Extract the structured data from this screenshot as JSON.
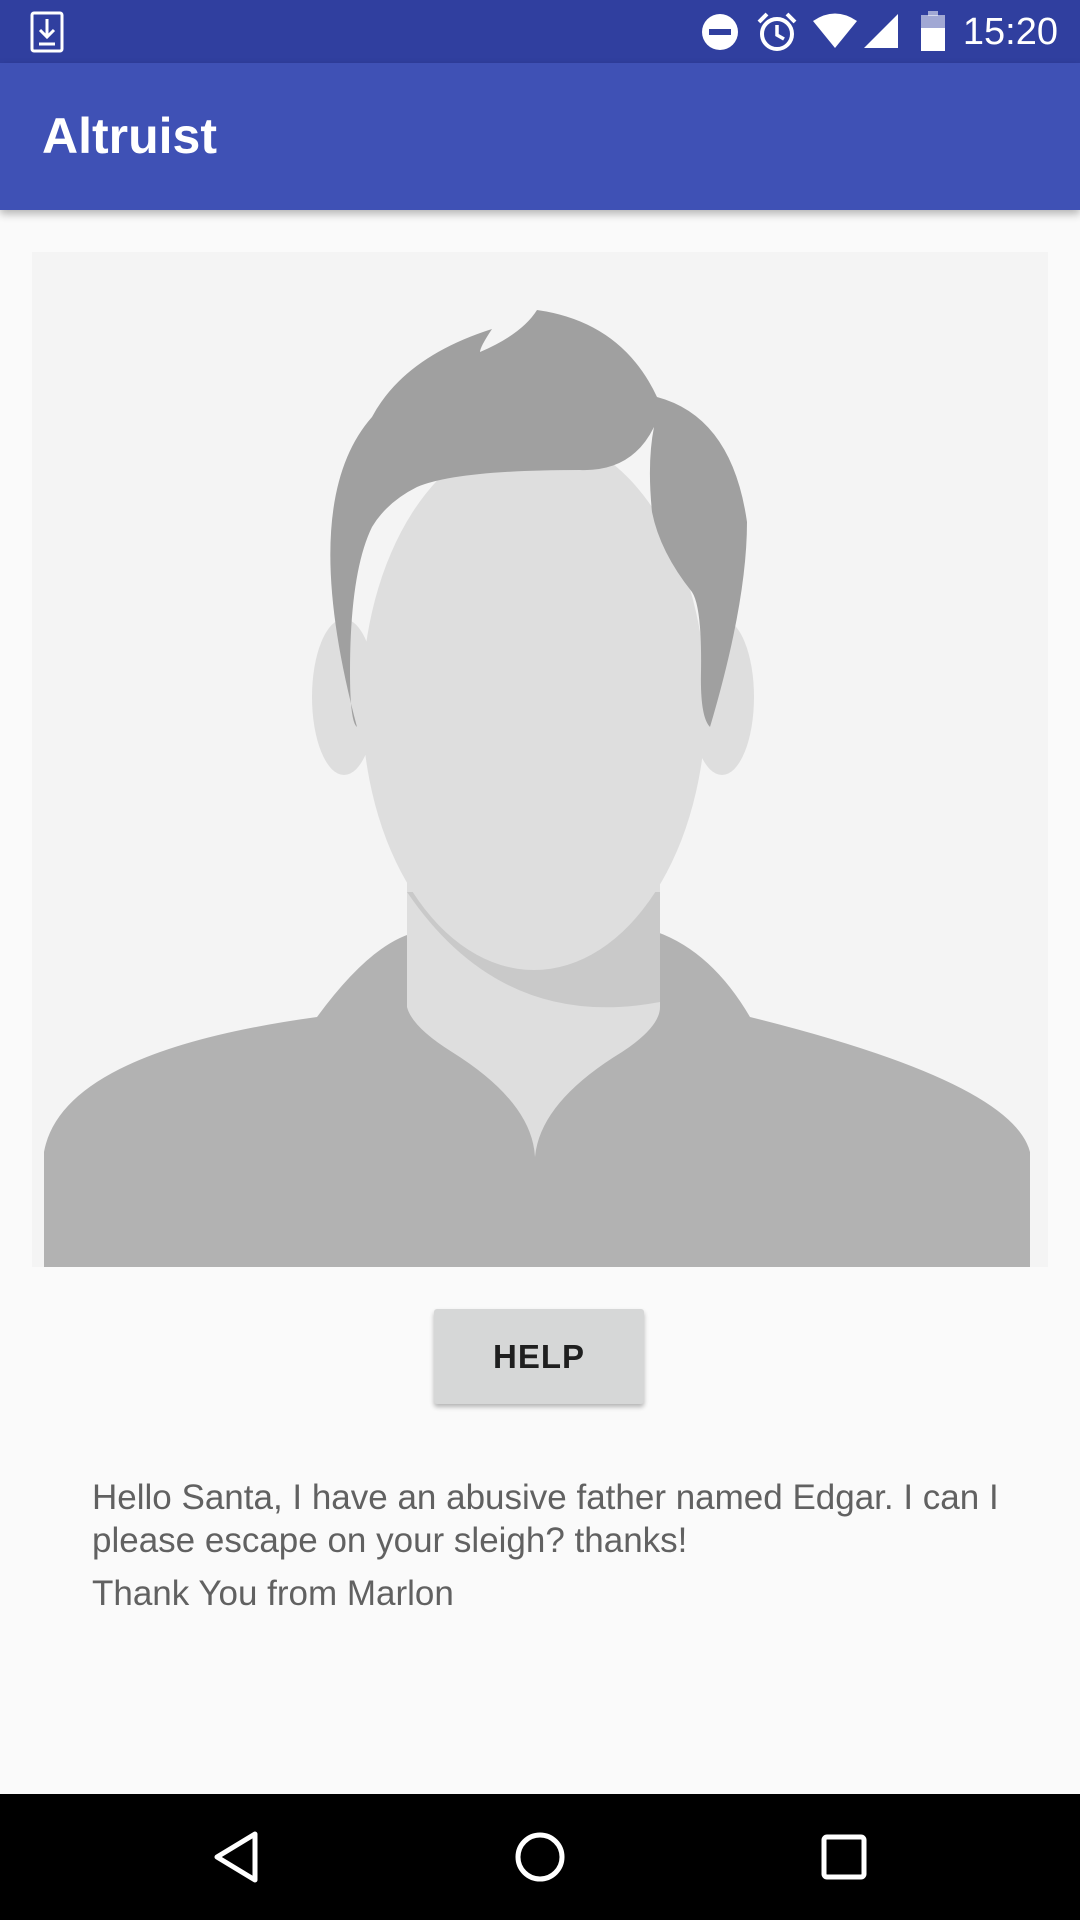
{
  "status_bar": {
    "time": "15:20",
    "icons": [
      "download-icon",
      "do-not-disturb-icon",
      "alarm-icon",
      "wifi-icon",
      "cell-signal-icon",
      "battery-icon"
    ],
    "background": "#303F9F"
  },
  "app_bar": {
    "title": "Altruist",
    "background": "#3F51B5"
  },
  "avatar": {
    "icon": "default-person-avatar"
  },
  "help_button": {
    "label": "HELP"
  },
  "message": {
    "text": "Hello Santa, I have an abusive father named Edgar. I can I please escape on your sleigh? thanks!",
    "signoff": "Thank You from Marlon"
  },
  "nav_bar": {
    "buttons": [
      "back-icon",
      "home-icon",
      "recents-icon"
    ]
  }
}
